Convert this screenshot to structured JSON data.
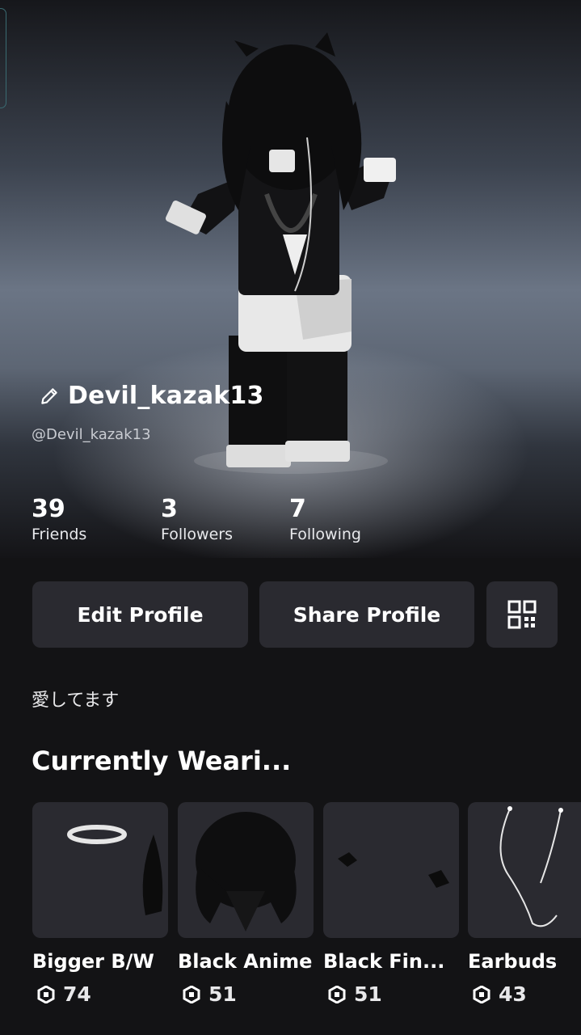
{
  "profile": {
    "display_name": "Devil_kazak13",
    "username": "@Devil_kazak13",
    "bio": "愛してます"
  },
  "stats": [
    {
      "value": "39",
      "label": "Friends"
    },
    {
      "value": "3",
      "label": "Followers"
    },
    {
      "value": "7",
      "label": "Following"
    }
  ],
  "actions": {
    "edit_label": "Edit Profile",
    "share_label": "Share Profile",
    "qr_icon": "qr-code-icon"
  },
  "wearing": {
    "title": "Currently Weari...",
    "items": [
      {
        "name": "Bigger B/W",
        "price": "74"
      },
      {
        "name": "Black Anime",
        "price": "51"
      },
      {
        "name": "Black Fin...",
        "price": "51"
      },
      {
        "name": "Earbuds",
        "price": "43"
      }
    ],
    "currency_icon": "robux-icon"
  }
}
